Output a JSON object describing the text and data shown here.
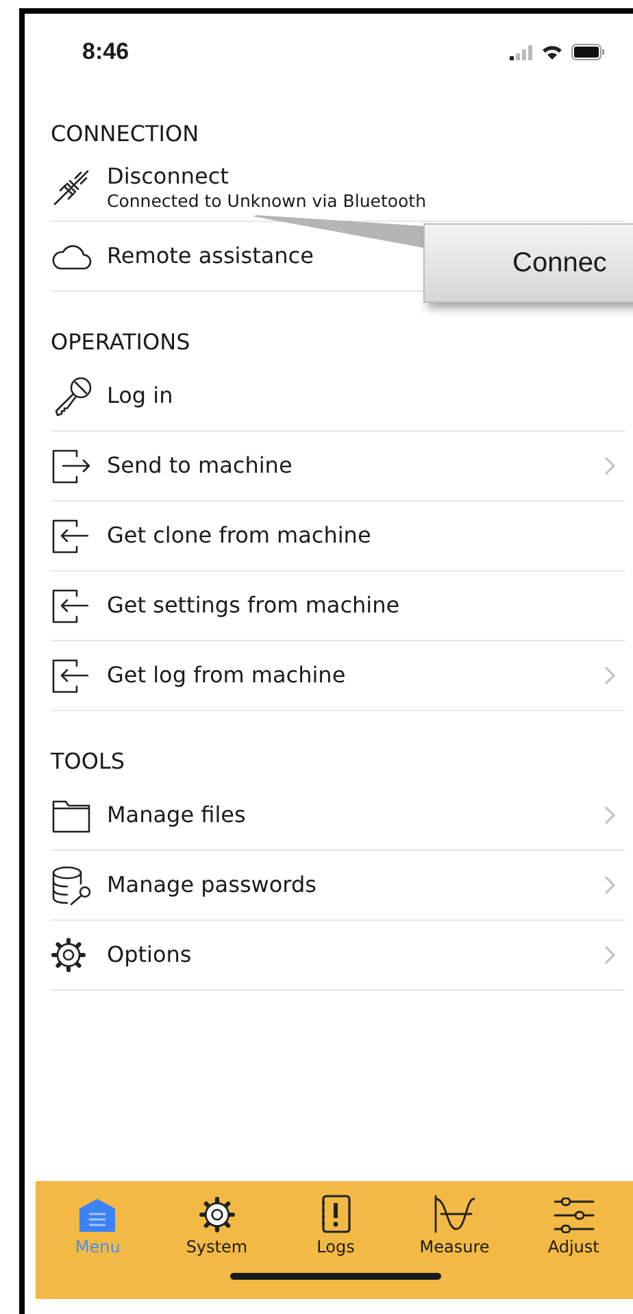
{
  "status_bar": {
    "time": "8:46"
  },
  "sections": [
    {
      "title": "CONNECTION",
      "items": [
        {
          "label": "Disconnect",
          "subtitle": "Connected to Unknown via Bluetooth",
          "chevron": false
        },
        {
          "label": "Remote assistance",
          "chevron": false
        }
      ]
    },
    {
      "title": "OPERATIONS",
      "items": [
        {
          "label": "Log in",
          "chevron": false
        },
        {
          "label": "Send to machine",
          "chevron": true
        },
        {
          "label": "Get clone from machine",
          "chevron": false
        },
        {
          "label": "Get settings from machine",
          "chevron": false
        },
        {
          "label": "Get log from machine",
          "chevron": true
        }
      ]
    },
    {
      "title": "TOOLS",
      "items": [
        {
          "label": "Manage files",
          "chevron": true
        },
        {
          "label": "Manage passwords",
          "chevron": true
        },
        {
          "label": "Options",
          "chevron": true
        }
      ]
    }
  ],
  "callout": {
    "text": "Connec"
  },
  "tab_bar": [
    {
      "label": "Menu",
      "selected": true
    },
    {
      "label": "System",
      "selected": false
    },
    {
      "label": "Logs",
      "selected": false
    },
    {
      "label": "Measure",
      "selected": false
    },
    {
      "label": "Adjust",
      "selected": false
    }
  ]
}
